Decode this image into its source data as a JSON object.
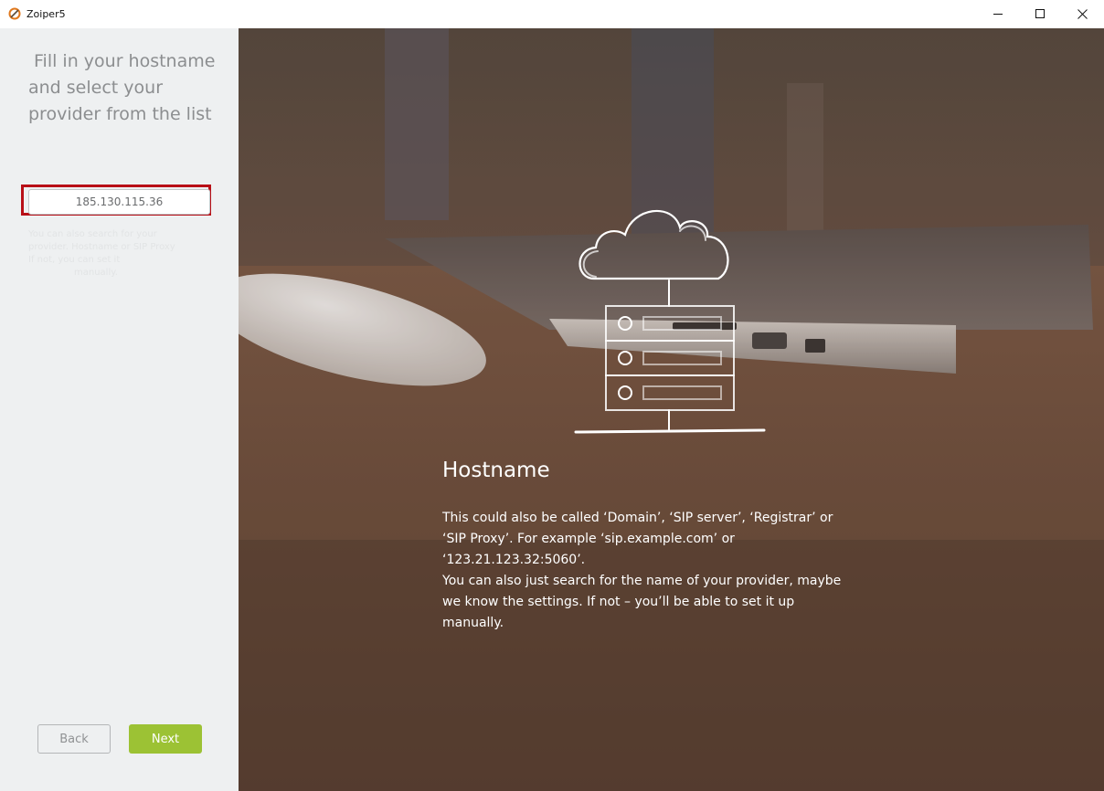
{
  "window": {
    "title": "Zoiper5",
    "controls": {
      "minimize_icon": "minimize-icon",
      "maximize_icon": "maximize-icon",
      "close_icon": "close-icon"
    }
  },
  "sidebar": {
    "heading_lines": [
      "Fill in your hostname",
      "and select your",
      "provider from the list"
    ],
    "hostname_input": {
      "value": "185.130.115.36",
      "placeholder": ""
    },
    "hint_lines": [
      "You can also search for your",
      "provider. Hostname or SIP Proxy",
      "If not, you can set it",
      "manually."
    ],
    "back_label": "Back",
    "next_label": "Next"
  },
  "info": {
    "title": "Hostname",
    "body_lines": [
      " This could also be called ‘Domain’, ‘SIP server’, ‘Registrar’ or",
      "‘SIP Proxy’. For example ‘sip.example.com’ or",
      "‘123.21.123.32:5060’.",
      "You can also just search for the name of your provider, maybe",
      "we know the settings. If not – you’ll be able to set it up",
      "manually."
    ],
    "illustration_icon": "cloud-server-icon"
  },
  "colors": {
    "accent": "#9cc234",
    "highlight_border": "#b80f17",
    "sidebar_bg": "#eef0f1",
    "heading_text": "#8c8e90"
  }
}
